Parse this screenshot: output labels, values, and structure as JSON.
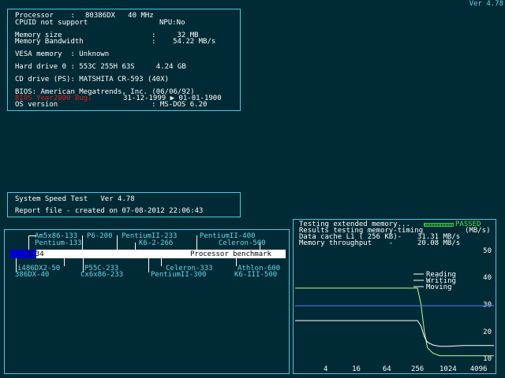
{
  "version": "Ver 4.78",
  "info": {
    "processor_label": "Processor    :",
    "processor_value": "80386DX   40 MHz",
    "cpuid": "CPUID not support",
    "npu": "NPU:No",
    "memory_size_label": "Memory size",
    "memory_size_value": ":     32 MB",
    "memory_bandwidth_label": "Memory Bandwidth",
    "memory_bandwidth_value": ":    54.22 MB/s",
    "vesa": "VESA memory  : Unknown",
    "hdd": "Hard drive 0 : 553C 255H 63S     4.24 GB",
    "cd": "CD drive (PS): MATSHITA CR-593 (40X)",
    "bios": "BIOS: American Megatrends, Inc. (06/06/92)",
    "y2k_label": "BIOS Year2000 Bug:",
    "y2k_value": "31-12-1999 ▶ 01-01-1900",
    "os_label": "OS version",
    "os_value": ": MS-DOS 6.20"
  },
  "speed_test": {
    "title": "System Speed Test   Ver 4.78",
    "report": "Report file - created on 07-08-2012 22:06:43"
  },
  "benchmark": {
    "score": "9.34",
    "score_value": 9.34,
    "label": "Processor benchmark",
    "top_refs": [
      "Am5x86-133",
      "P6-200",
      "PentiumII-233",
      "PentiumII-400",
      "Pentium-133",
      "K6-2-266",
      "Celeron-500"
    ],
    "bottom_refs": [
      "i486DX2-50",
      "P55C-233",
      "Celeron-333",
      "Athlon-600",
      "386DX-40",
      "Cx6x86-233",
      "PentiumII-300",
      "K6-III-500"
    ]
  },
  "memtest": {
    "line1": "Testing extended memory...",
    "passed": "PASSED",
    "line2": "Results testing memory-timing",
    "unit": "(MB/s)",
    "cache_label": "Data cache L1 ( 256 KB)-",
    "cache_value": "31.31 MB/s",
    "throughput_label": "Memory throughput    -",
    "throughput_value": "20.08 MB/s"
  },
  "chart_data": {
    "type": "line",
    "x_ticks": [
      "4",
      "16",
      "64",
      "256",
      "1024",
      "4096"
    ],
    "y_ticks": [
      "50",
      "40",
      "30",
      "20",
      "10"
    ],
    "ylim": [
      8,
      52
    ],
    "legend_position": "top-right",
    "series": [
      {
        "name": "Reading",
        "color": "#b7ff9a",
        "x": [
          1,
          4,
          16,
          64,
          256,
          300,
          350,
          400,
          512,
          700,
          1024,
          2048,
          4096,
          8192
        ],
        "values": [
          36,
          36,
          36,
          36,
          36,
          30,
          20,
          14,
          12,
          11,
          11,
          11,
          11,
          11
        ]
      },
      {
        "name": "Writing",
        "color": "#5a78ff",
        "x": [
          1,
          4,
          16,
          64,
          256,
          1024,
          4096,
          8192
        ],
        "values": [
          29.5,
          29.5,
          29.5,
          29.5,
          29.5,
          29.5,
          29.5,
          29.5
        ]
      },
      {
        "name": "Moving",
        "color": "#ffffff",
        "x": [
          1,
          4,
          16,
          64,
          256,
          300,
          350,
          400,
          512,
          700,
          1024,
          2048,
          4096,
          8192
        ],
        "values": [
          24,
          24,
          24,
          24,
          24,
          22,
          18,
          16,
          15,
          14.5,
          14.5,
          14.8,
          14.8,
          14.8
        ]
      }
    ]
  }
}
